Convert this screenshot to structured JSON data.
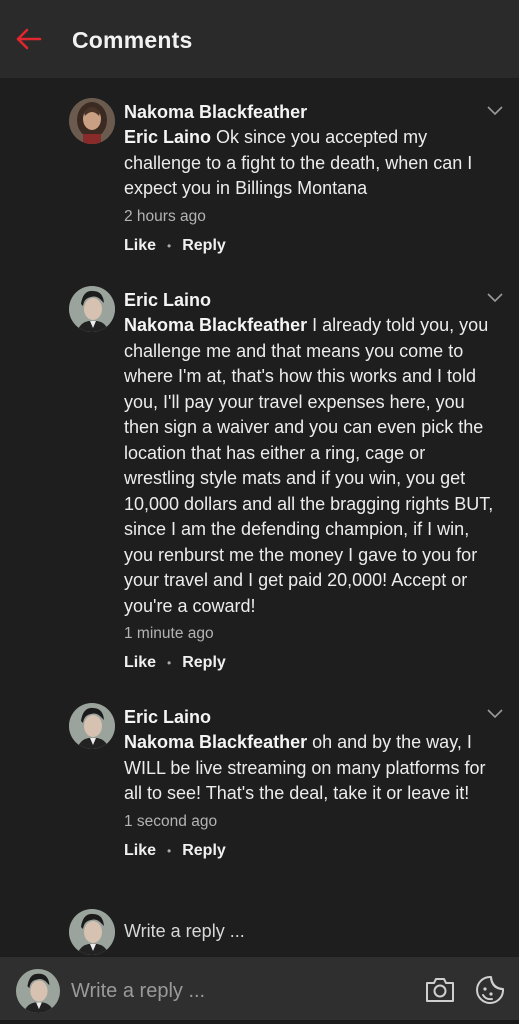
{
  "header": {
    "title": "Comments"
  },
  "colors": {
    "accent": "#e0262e",
    "background": "#1e1e1e",
    "header": "#2a2a2a"
  },
  "comments": [
    {
      "author": "Nakoma Blackfeather",
      "mention": "Eric Laino",
      "text": " Ok since you accepted my challenge to a fight to the death, when can I expect you in Billings Montana",
      "time": "2 hours ago",
      "like": "Like",
      "reply": "Reply"
    },
    {
      "author": "Eric Laino",
      "mention": "Nakoma Blackfeather",
      "text": "  I already told you, you challenge me and that means you come to where I'm at, that's how this works and I told you, I'll pay your travel expenses here, you then sign a waiver and you can even pick the location that has either a ring, cage or wrestling style mats and if you win, you get 10,000 dollars and all the bragging rights BUT, since I am the defending champion, if I win, you renburst me the money I gave to you for your travel and I get paid 20,000! Accept or you're a coward!",
      "time": "1 minute ago",
      "like": "Like",
      "reply": "Reply"
    },
    {
      "author": "Eric Laino",
      "mention": "Nakoma Blackfeather",
      "text": "  oh and by the way, I WILL be live streaming on many platforms for all to see! That's the deal, take it or leave it!",
      "time": "1 second ago",
      "like": "Like",
      "reply": "Reply"
    }
  ],
  "inline_reply": {
    "placeholder": "Write a reply ..."
  },
  "bottom_bar": {
    "placeholder": "Write a reply ...",
    "icons": [
      "camera-icon",
      "sticker-icon"
    ]
  }
}
